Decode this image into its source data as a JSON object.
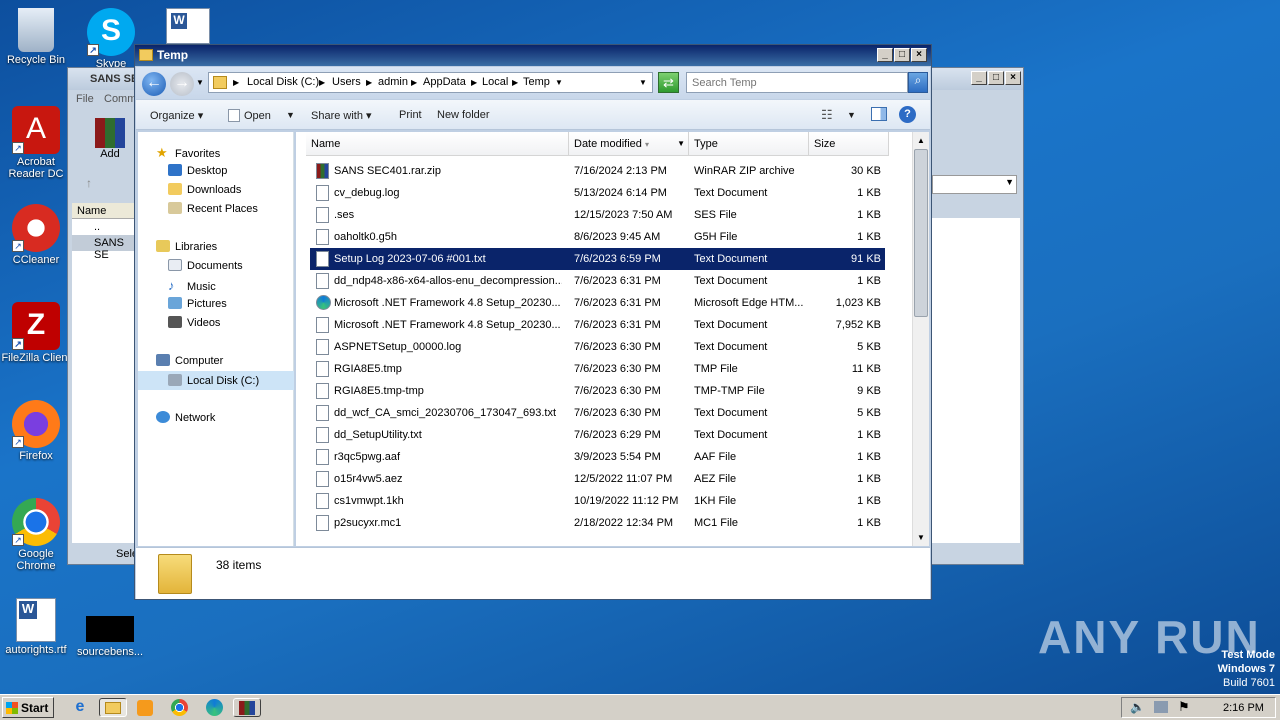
{
  "desktop": {
    "icons": [
      {
        "label": "Recycle Bin"
      },
      {
        "label": "Skype"
      },
      {
        "label": "Acrobat Reader DC"
      },
      {
        "label": "CCleaner"
      },
      {
        "label": "FileZilla Client"
      },
      {
        "label": "Firefox"
      },
      {
        "label": "Google Chrome"
      },
      {
        "label": "autorights.rtf"
      },
      {
        "label": "sourcebens..."
      }
    ],
    "watermark": "ANY RUN",
    "os_info": [
      "Test Mode",
      "Windows 7",
      "Build 7601"
    ]
  },
  "background_window": {
    "title": "SANS SE",
    "menu": [
      "File",
      "Comm"
    ],
    "add_label": "Add",
    "name_header": "Name",
    "rows": [
      "..",
      "SANS SE"
    ],
    "status": "Sele"
  },
  "explorer": {
    "title": "Temp",
    "breadcrumb": [
      "Local Disk (C:)",
      "Users",
      "admin",
      "AppData",
      "Local",
      "Temp"
    ],
    "search_placeholder": "Search Temp",
    "toolbar": {
      "organize": "Organize",
      "open": "Open",
      "share_with": "Share with",
      "print": "Print",
      "new_folder": "New folder"
    },
    "nav": {
      "favorites": "Favorites",
      "desktop": "Desktop",
      "downloads": "Downloads",
      "recent": "Recent Places",
      "libraries": "Libraries",
      "documents": "Documents",
      "music": "Music",
      "pictures": "Pictures",
      "videos": "Videos",
      "computer": "Computer",
      "local_disk": "Local Disk (C:)",
      "network": "Network"
    },
    "columns": {
      "name": "Name",
      "date": "Date modified",
      "type": "Type",
      "size": "Size"
    },
    "files": [
      {
        "name": "SANS SEC401.rar.zip",
        "date": "7/16/2024 2:13 PM",
        "type": "WinRAR ZIP archive",
        "size": "30 KB"
      },
      {
        "name": "cv_debug.log",
        "date": "5/13/2024 6:14 PM",
        "type": "Text Document",
        "size": "1 KB"
      },
      {
        "name": ".ses",
        "date": "12/15/2023 7:50 AM",
        "type": "SES File",
        "size": "1 KB"
      },
      {
        "name": "oaholtk0.g5h",
        "date": "8/6/2023 9:45 AM",
        "type": "G5H File",
        "size": "1 KB"
      },
      {
        "name": "Setup Log 2023-07-06 #001.txt",
        "date": "7/6/2023 6:59 PM",
        "type": "Text Document",
        "size": "91 KB"
      },
      {
        "name": "dd_ndp48-x86-x64-allos-enu_decompression...",
        "date": "7/6/2023 6:31 PM",
        "type": "Text Document",
        "size": "1 KB"
      },
      {
        "name": "Microsoft .NET Framework 4.8 Setup_20230...",
        "date": "7/6/2023 6:31 PM",
        "type": "Microsoft Edge HTM...",
        "size": "1,023 KB"
      },
      {
        "name": "Microsoft .NET Framework 4.8 Setup_20230...",
        "date": "7/6/2023 6:31 PM",
        "type": "Text Document",
        "size": "7,952 KB"
      },
      {
        "name": "ASPNETSetup_00000.log",
        "date": "7/6/2023 6:30 PM",
        "type": "Text Document",
        "size": "5 KB"
      },
      {
        "name": "RGIA8E5.tmp",
        "date": "7/6/2023 6:30 PM",
        "type": "TMP File",
        "size": "11 KB"
      },
      {
        "name": "RGIA8E5.tmp-tmp",
        "date": "7/6/2023 6:30 PM",
        "type": "TMP-TMP File",
        "size": "9 KB"
      },
      {
        "name": "dd_wcf_CA_smci_20230706_173047_693.txt",
        "date": "7/6/2023 6:30 PM",
        "type": "Text Document",
        "size": "5 KB"
      },
      {
        "name": "dd_SetupUtility.txt",
        "date": "7/6/2023 6:29 PM",
        "type": "Text Document",
        "size": "1 KB"
      },
      {
        "name": "r3qc5pwg.aaf",
        "date": "3/9/2023 5:54 PM",
        "type": "AAF File",
        "size": "1 KB"
      },
      {
        "name": "o15r4vw5.aez",
        "date": "12/5/2022 11:07 PM",
        "type": "AEZ File",
        "size": "1 KB"
      },
      {
        "name": "cs1vmwpt.1kh",
        "date": "10/19/2022 11:12 PM",
        "type": "1KH File",
        "size": "1 KB"
      },
      {
        "name": "p2sucyxr.mc1",
        "date": "2/18/2022 12:34 PM",
        "type": "MC1 File",
        "size": "1 KB"
      }
    ],
    "status_items": "38 items"
  },
  "taskbar": {
    "start": "Start",
    "clock": "2:16 PM"
  }
}
